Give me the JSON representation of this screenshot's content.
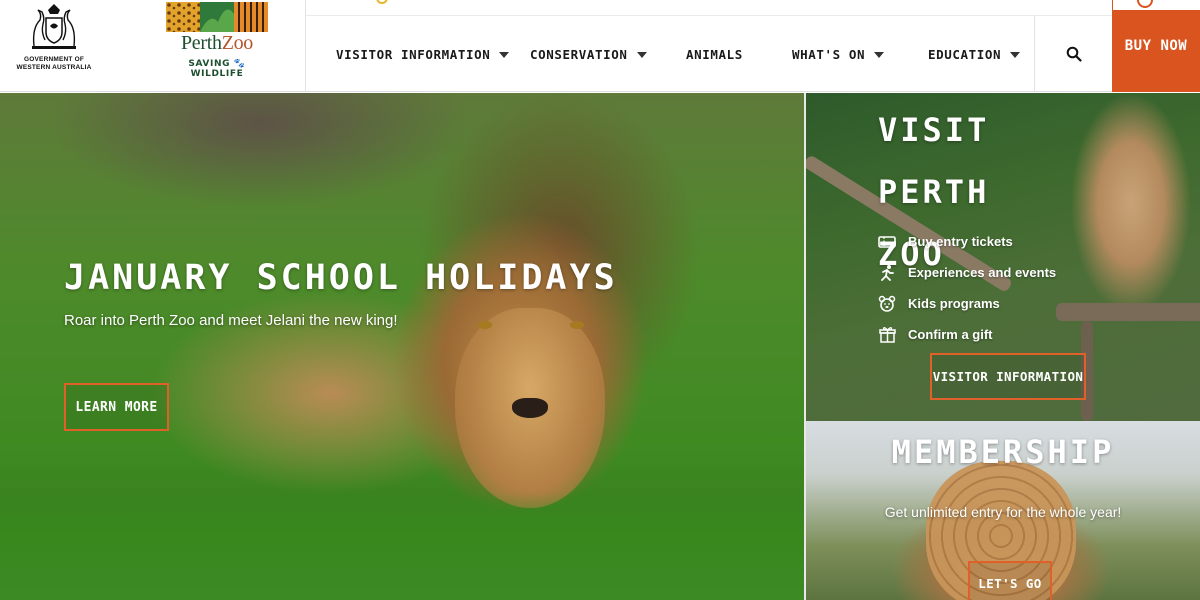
{
  "header": {
    "gov_logo_text": [
      "GOVERNMENT OF",
      "WESTERN AUSTRALIA"
    ],
    "zoo_logo": {
      "name_part1": "Perth",
      "name_part2": "Zoo",
      "tagline_part1": "SAVING",
      "tagline_part2": "WILDLIFE"
    },
    "nav": [
      {
        "label": "VISITOR INFORMATION",
        "has_dropdown": true
      },
      {
        "label": "CONSERVATION",
        "has_dropdown": true
      },
      {
        "label": "ANIMALS",
        "has_dropdown": false
      },
      {
        "label": "WHAT'S ON",
        "has_dropdown": true
      },
      {
        "label": "EDUCATION",
        "has_dropdown": true
      }
    ],
    "search_icon": "search-icon",
    "buy_now_label": "BUY NOW",
    "accent_color": "#d9541e"
  },
  "hero": {
    "title": "JANUARY SCHOOL HOLIDAYS",
    "subtitle": "Roar into Perth Zoo and meet Jelani the new king!",
    "button_label": "LEARN MORE"
  },
  "visit": {
    "title": "VISIT PERTH ZOO",
    "items": [
      {
        "label": "Buy entry tickets",
        "icon": "ticket-icon"
      },
      {
        "label": "Experiences and events",
        "icon": "running-icon"
      },
      {
        "label": "Kids programs",
        "icon": "bear-face-icon"
      },
      {
        "label": "Confirm a gift",
        "icon": "gift-icon"
      }
    ],
    "button_label": "VISITOR INFORMATION"
  },
  "membership": {
    "title": "MEMBERSHIP",
    "subtitle": "Get unlimited entry for the whole year!",
    "button_label": "LET'S GO"
  }
}
